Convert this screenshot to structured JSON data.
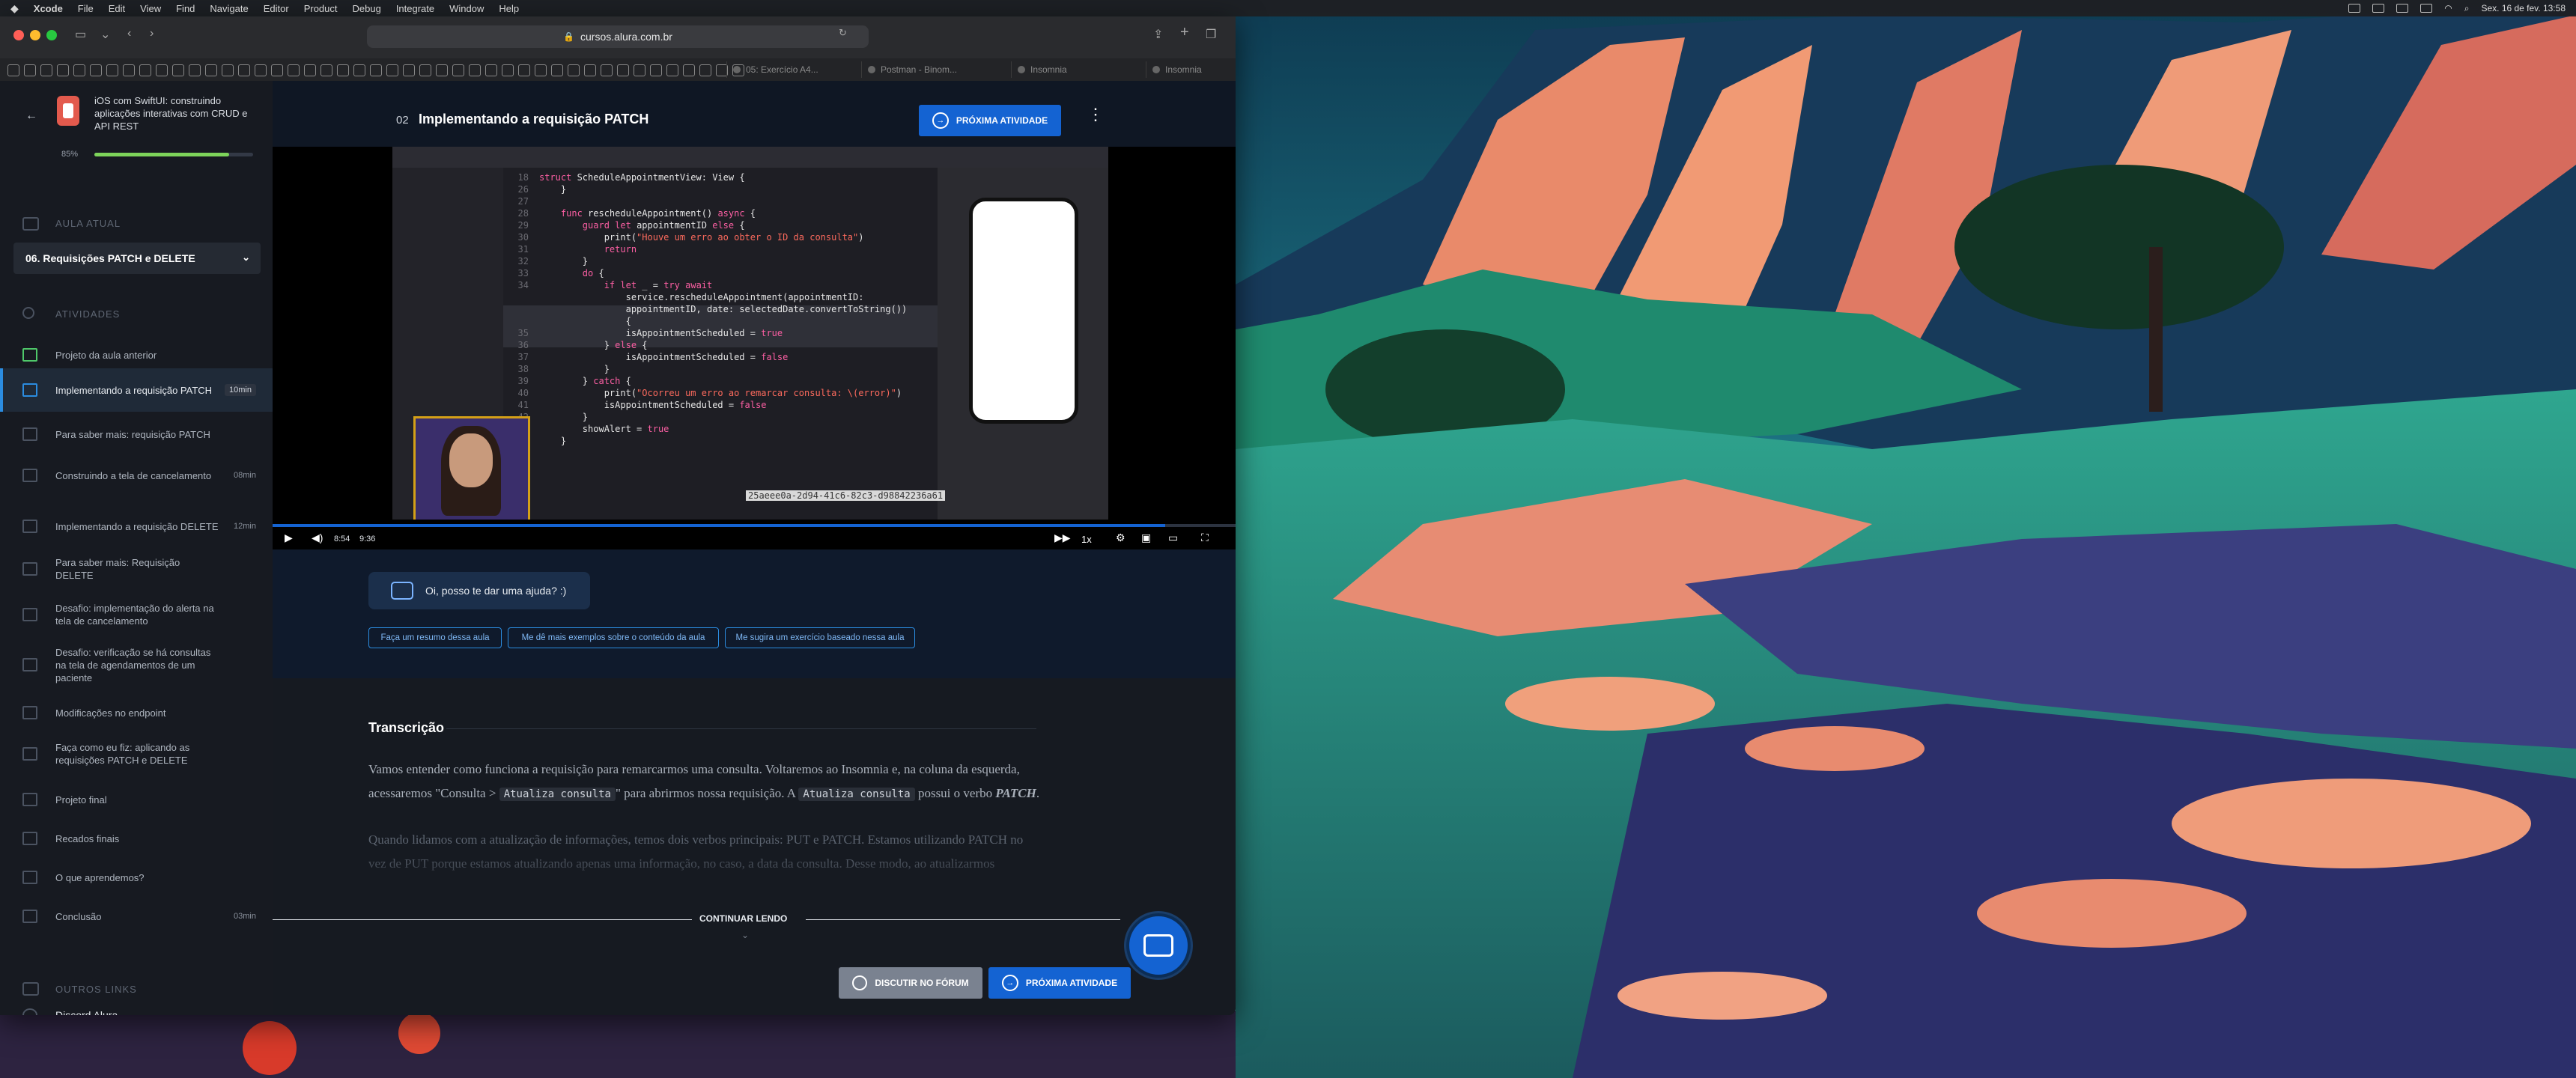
{
  "menubar": {
    "apple": "",
    "items": [
      "Xcode",
      "File",
      "Edit",
      "View",
      "Find",
      "Navigate",
      "Editor",
      "Product",
      "Debug",
      "Integrate",
      "Window",
      "Help"
    ],
    "clock": "Sex. 16 de fev. 13:58"
  },
  "browser": {
    "url": "cursos.alura.com.br",
    "tabs": [
      {
        "label": "05: Exercício A4..."
      },
      {
        "label": "Postman - Binom..."
      },
      {
        "label": "Insomnia"
      },
      {
        "label": "Insomnia"
      }
    ]
  },
  "course": {
    "title": "iOS com SwiftUI: construindo aplicações interativas com CRUD e API REST",
    "progress_label": "85%",
    "progress": 0.85
  },
  "sidebar": {
    "current_section_label": "AULA ATUAL",
    "current_lesson": "06. Requisições PATCH e DELETE",
    "activities_label": "ATIVIDADES",
    "activities": [
      {
        "label": "Projeto da aula anterior",
        "duration": "",
        "active": false
      },
      {
        "label": "Implementando a requisição PATCH",
        "duration": "10min",
        "active": true
      },
      {
        "label": "Para saber mais: requisição PATCH",
        "duration": "",
        "active": false
      },
      {
        "label": "Construindo a tela de cancelamento",
        "duration": "08min",
        "active": false
      },
      {
        "label": "Implementando a requisição DELETE",
        "duration": "12min",
        "active": false
      },
      {
        "label": "Para saber mais: Requisição DELETE",
        "duration": "",
        "active": false
      },
      {
        "label": "Desafio: implementação do alerta na tela de cancelamento",
        "duration": "",
        "active": false
      },
      {
        "label": "Desafio: verificação se há consultas na tela de agendamentos de um paciente",
        "duration": "",
        "active": false
      },
      {
        "label": "Modificações no endpoint",
        "duration": "",
        "active": false
      },
      {
        "label": "Faça como eu fiz: aplicando as requisições PATCH e DELETE",
        "duration": "",
        "active": false
      },
      {
        "label": "Projeto final",
        "duration": "",
        "active": false
      },
      {
        "label": "Recados finais",
        "duration": "",
        "active": false
      },
      {
        "label": "O que aprendemos?",
        "duration": "",
        "active": false
      },
      {
        "label": "Conclusão",
        "duration": "03min",
        "active": false
      }
    ],
    "other_links_label": "OUTROS LINKS",
    "discord": "Discord Alura"
  },
  "lesson": {
    "number": "02",
    "title": "Implementando a requisição PATCH",
    "next_label": "PRÓXIMA ATIVIDADE"
  },
  "video": {
    "current_time": "8:54",
    "total_time": "9:36",
    "progress": 0.927,
    "speed": "1x",
    "overlay_uuid": "25aeee0a-2d94-41c6-82c3-d98842236a61",
    "code_lines": [
      {
        "n": "18",
        "text": "struct ScheduleAppointmentView: View {"
      },
      {
        "n": "26",
        "text": "    }"
      },
      {
        "n": "27",
        "text": ""
      },
      {
        "n": "28",
        "text": "    func rescheduleAppointment() async {"
      },
      {
        "n": "29",
        "text": "        guard let appointmentID else {"
      },
      {
        "n": "30",
        "text": "            print(\"Houve um erro ao obter o ID da consulta\")"
      },
      {
        "n": "31",
        "text": "            return"
      },
      {
        "n": "32",
        "text": "        }"
      },
      {
        "n": "33",
        "text": "        do {"
      },
      {
        "n": "34",
        "text": "            if let _ = try await"
      },
      {
        "n": "",
        "text": "                service.rescheduleAppointment(appointmentID:"
      },
      {
        "n": "",
        "text": "                appointmentID, date: selectedDate.convertToString())"
      },
      {
        "n": "",
        "text": "                {"
      },
      {
        "n": "35",
        "text": "                isAppointmentScheduled = true"
      },
      {
        "n": "36",
        "text": "            } else {"
      },
      {
        "n": "37",
        "text": "                isAppointmentScheduled = false"
      },
      {
        "n": "38",
        "text": "            }"
      },
      {
        "n": "39",
        "text": "        } catch {"
      },
      {
        "n": "40",
        "text": "            print(\"Ocorreu um erro ao remarcar consulta: \\(error)\")"
      },
      {
        "n": "41",
        "text": "            isAppointmentScheduled = false"
      },
      {
        "n": "42",
        "text": "        }"
      },
      {
        "n": "43",
        "text": "        showAlert = true"
      },
      {
        "n": "44",
        "text": "    }"
      }
    ]
  },
  "assistant": {
    "greeting": "Oi, posso te dar uma ajuda? :)",
    "suggestions": [
      "Faça um resumo dessa aula",
      "Me dê mais exemplos sobre o conteúdo da aula",
      "Me sugira um exercício baseado nessa aula"
    ]
  },
  "transcript": {
    "title": "Transcrição",
    "p1_a": "Vamos entender como funciona a requisição para remarcarmos uma consulta. Voltaremos ao Insomnia e, na coluna da esquerda, acessaremos \"Consulta > ",
    "p1_code1": "Atualiza consulta",
    "p1_b": "\" para abrirmos nossa requisição. A ",
    "p1_code2": "Atualiza consulta",
    "p1_c": " possui o verbo ",
    "p1_verb": "PATCH",
    "p1_end": ".",
    "p2": "Quando lidamos com a atualização de informações, temos dois verbos principais: PUT e PATCH. Estamos utilizando PATCH no vez de PUT porque estamos atualizando apenas uma informação, no caso, a data da consulta. Desse modo, ao atualizarmos",
    "continue_label": "CONTINUAR LENDO",
    "forum_label": "DISCUTIR NO FÓRUM",
    "next_label": "PRÓXIMA ATIVIDADE"
  },
  "colors": {
    "accent": "#1463d2",
    "progress_green": "#7dd45a",
    "sidebar_bg": "#171a21"
  }
}
